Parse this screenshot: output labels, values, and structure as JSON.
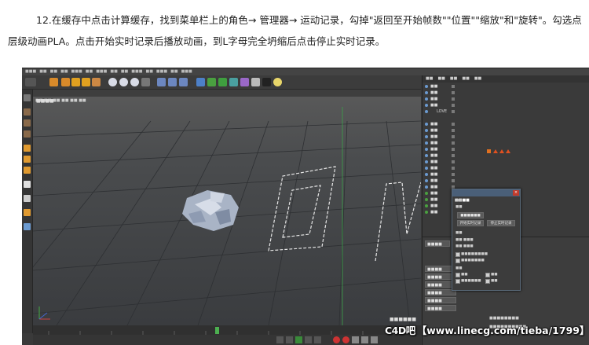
{
  "article": {
    "line1": "12.在缓存中点击计算缓存，找到菜单栏上的角色→ 管理器→ 运动记录，勾掉\"返回至开始帧数\"\"位置\"\"缩放\"和\"旋转\"。勾选点",
    "line2": "层级动画PLA。点击开始实时记录后播放动画，到L字母完全坍缩后点击停止实时记录。"
  },
  "screenshot": {
    "object_list": [
      "LOVE"
    ],
    "dialog": {
      "start_button": "开始实时记录",
      "stop_button": "停止实时记录"
    },
    "watermark": {
      "logo": "C4D吧",
      "text": "【www.linecg.com/tieba/1799】"
    }
  }
}
